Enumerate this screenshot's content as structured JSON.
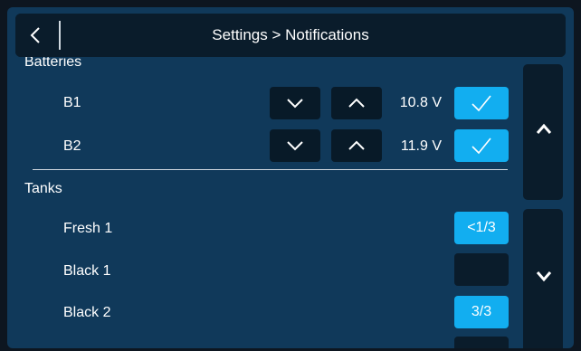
{
  "header": {
    "title": "Settings > Notifications",
    "back_icon": "chevron-left-icon"
  },
  "sections": {
    "batteries": {
      "label": "Batteries",
      "items": [
        {
          "label": "B1",
          "value": "10.8 V",
          "enabled": true
        },
        {
          "label": "B2",
          "value": "11.9 V",
          "enabled": true
        }
      ]
    },
    "tanks": {
      "label": "Tanks",
      "items": [
        {
          "label": "Fresh 1",
          "threshold": "<1/3",
          "enabled": true
        },
        {
          "label": "Black 1",
          "threshold": "",
          "enabled": false
        },
        {
          "label": "Black 2",
          "threshold": "3/3",
          "enabled": true
        }
      ]
    }
  },
  "icons": {
    "decrease": "chevron-down-icon",
    "increase": "chevron-up-icon",
    "check": "check-icon"
  },
  "colors": {
    "background": "#10395a",
    "header": "#0a1c2b",
    "button": "#081a28",
    "accent": "#12aef0"
  }
}
